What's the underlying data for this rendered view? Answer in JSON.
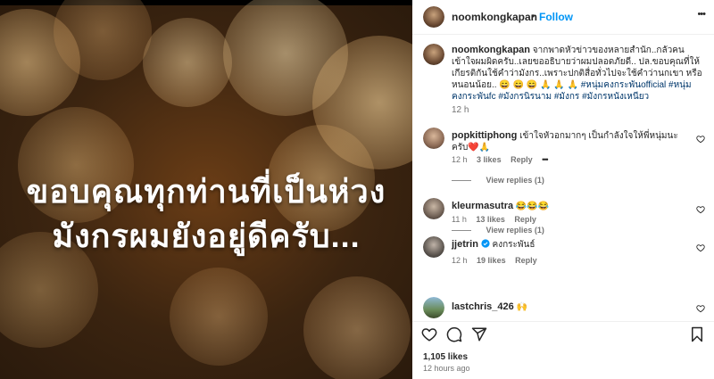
{
  "media": {
    "caption_line1": "ขอบคุณทุกท่านที่เป็นห่วง",
    "caption_line2": "มังกรผมยังอยู่ดีครับ..."
  },
  "header": {
    "username": "noomkongkapan",
    "separator": "•",
    "follow_label": "Follow",
    "more": "•••"
  },
  "post_caption": {
    "username": "noomkongkapan",
    "text": "จากพาดหัวข่าวของหลายสำนัก..กลัวคนเข้าใจผมผิดครับ..เลยขออธิบายว่าผมปลอดภัยดี.. ปล.ขอบคุณที่ให้เกียรติกันใช้คำว่ามังกร..เพราะปกติสื่อทั่วไปจะใช้คำว่านกเขา หรือหนอนน้อย.. 😄 😄 😄 🙏 🙏 🙏",
    "hashtags": "#หนุ่มคงกระพันofficial #หนุ่มคงกระพันfc #มังกรนิรนาม #มังกร #มังกรหนังเหนียว",
    "time": "12 h"
  },
  "comments": [
    {
      "username": "popkittiphong",
      "text": "เข้าใจหัวอกมากๆ เป็นกำลังใจให้พี่หนุ่มนะครับ❤️🙏",
      "time": "12 h",
      "likes": "3 likes",
      "reply": "Reply",
      "more": "•••",
      "view_replies": "View replies (1)"
    },
    {
      "username": "kleurmasutra",
      "text": "😂😂😂",
      "time": "11 h",
      "likes": "13 likes",
      "reply": "Reply",
      "view_replies": "View replies (1)"
    },
    {
      "username": "jjetrin",
      "verified": true,
      "text": "คงกระพันธ์",
      "time": "12 h",
      "likes": "19 likes",
      "reply": "Reply"
    },
    {
      "username": "lastchris_426",
      "text": "🙌"
    }
  ],
  "footer": {
    "likes": "1,105 likes",
    "time_ago": "12 hours ago"
  },
  "icons": [
    "heart-icon",
    "comment-icon",
    "share-icon",
    "bookmark-icon",
    "verified-icon",
    "more-icon"
  ],
  "colors": {
    "follow": "#0095f6",
    "link": "#00376b",
    "heart_red": "#ed4956"
  }
}
